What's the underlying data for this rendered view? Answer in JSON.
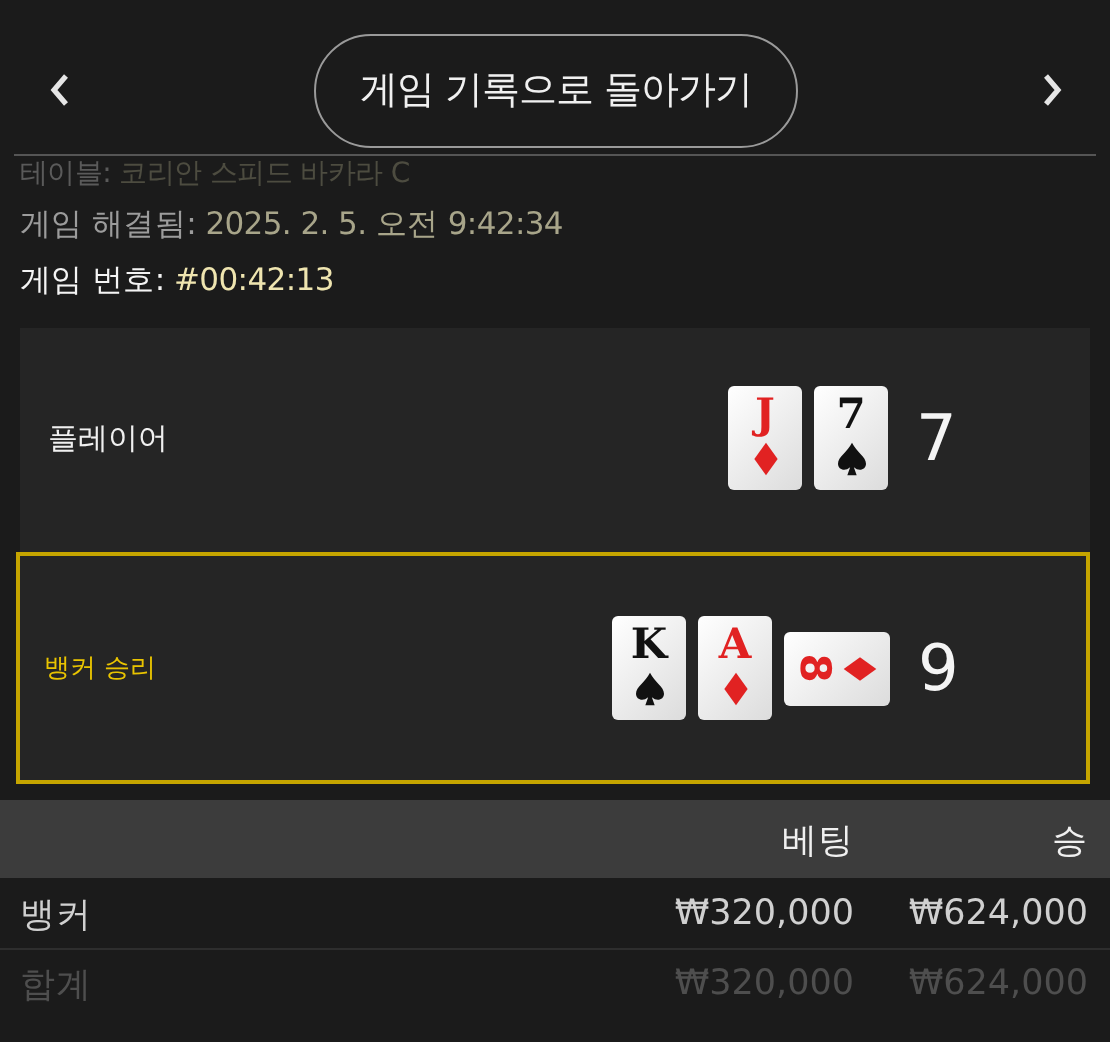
{
  "header": {
    "back_button": "게임 기록으로 돌아가기"
  },
  "info": [
    {
      "label": "테이블:",
      "value": "코리안 스피드 바카라 C",
      "kind": "faded"
    },
    {
      "label": "게임 해결됨:",
      "value": "2025. 2. 5. 오전 9:42:34",
      "kind": "normal"
    },
    {
      "label": "게임 번호:",
      "value": "#00:42:13",
      "kind": "current"
    }
  ],
  "hands": [
    {
      "name": "플레이어",
      "winner": false,
      "total": "7",
      "cards": [
        {
          "rank": "J",
          "kind": "diamond",
          "rotated": false
        },
        {
          "rank": "7",
          "kind": "spade",
          "rotated": false
        }
      ]
    },
    {
      "name": "뱅커 승리",
      "winner": true,
      "total": "9",
      "cards": [
        {
          "rank": "K",
          "kind": "spade",
          "rotated": false
        },
        {
          "rank": "A",
          "kind": "diamond",
          "rotated": false
        },
        {
          "rank": "8",
          "kind": "diamond",
          "rotated": true
        }
      ]
    }
  ],
  "table": {
    "columns": [
      "",
      "베팅",
      "승"
    ],
    "rows": [
      {
        "kind": "bet",
        "cells": [
          "뱅커",
          "₩320,000",
          "₩624,000"
        ]
      },
      {
        "kind": "total",
        "cells": [
          "합계",
          "₩320,000",
          "₩624,000"
        ]
      }
    ]
  }
}
